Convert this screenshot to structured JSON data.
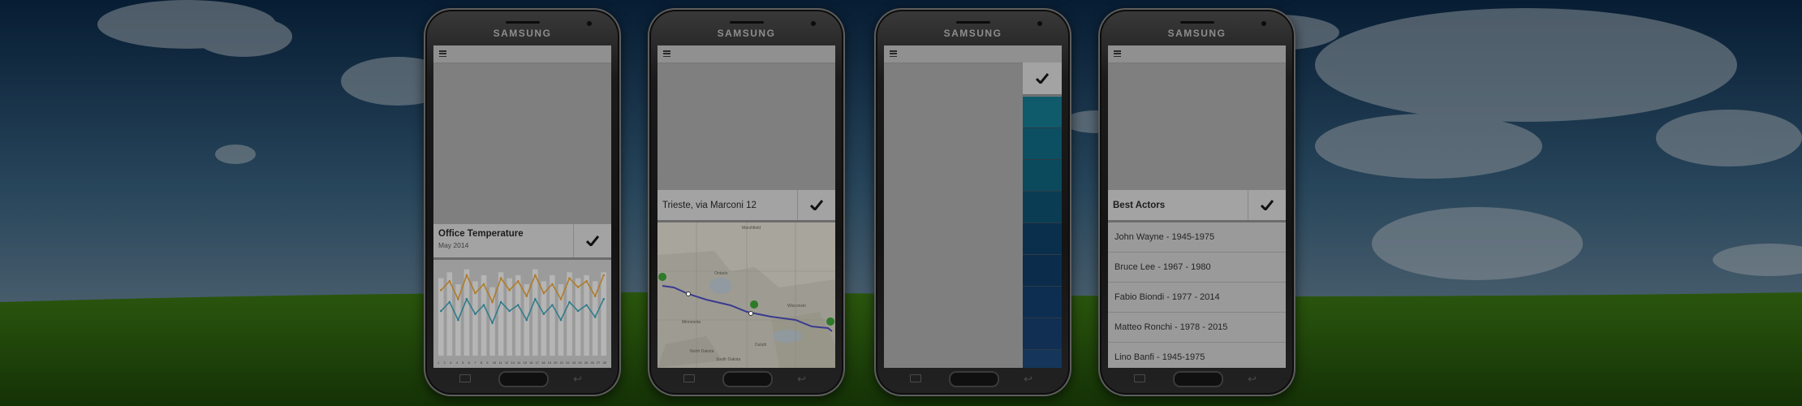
{
  "background": {
    "sky_top": "#0d2f52",
    "sky_bottom": "#5b7f99",
    "grass": "#2f6a12",
    "dim_overlay": "#000000"
  },
  "phones": [
    {
      "brand": "SAMSUNG",
      "menu_icon": "hamburger-menu-icon",
      "card": {
        "title": "Office Temperature",
        "subtitle": "May 2014",
        "confirm_icon": "checkmark-icon"
      },
      "chart": {
        "series": [
          {
            "values": [
              22,
              25,
              19,
              27,
              21,
              24,
              18,
              26,
              22,
              25,
              20,
              27,
              21,
              24,
              19,
              26,
              23,
              25,
              20,
              27
            ],
            "color": "#b07a24"
          },
          {
            "values": [
              15,
              18,
              12,
              19,
              14,
              17,
              11,
              18,
              15,
              17,
              12,
              19,
              14,
              17,
              12,
              18,
              15,
              17,
              13,
              19
            ],
            "color": "#2c7a8a"
          }
        ],
        "bars": [
          14,
          16,
          12,
          17,
          13,
          15,
          11,
          16,
          14,
          15,
          12,
          17,
          13,
          15,
          12,
          16,
          14,
          15,
          13,
          16
        ],
        "tick_labels": [
          "1",
          "2",
          "3",
          "4",
          "5",
          "6",
          "7",
          "8",
          "9",
          "10",
          "11",
          "12",
          "13",
          "14",
          "15",
          "16",
          "17",
          "18",
          "19",
          "20",
          "21",
          "22",
          "23",
          "24",
          "25",
          "26",
          "27",
          "28"
        ]
      }
    },
    {
      "brand": "SAMSUNG",
      "menu_icon": "hamburger-menu-icon",
      "card": {
        "title": "Trieste, via Marconi 12",
        "confirm_icon": "checkmark-icon"
      },
      "map": {
        "labels": [
          "Marshfield",
          "Ontario",
          "Duluth",
          "Minnesota",
          "North Dakota",
          "South Dakota",
          "Wisconsin"
        ],
        "route_color": "#3b3a8e",
        "marker_color": "#2e7a2a"
      }
    },
    {
      "brand": "SAMSUNG",
      "menu_icon": "hamburger-menu-icon",
      "confirm_icon": "checkmark-icon",
      "swatches": [
        "#0f5b6c",
        "#0c4e62",
        "#0a4a5c",
        "#0a3d53",
        "#0a2f4d",
        "#0c2c4b",
        "#0d2e50",
        "#102f52",
        "#15365a"
      ]
    },
    {
      "brand": "SAMSUNG",
      "menu_icon": "hamburger-menu-icon",
      "card": {
        "title": "Best Actors",
        "confirm_icon": "checkmark-icon"
      },
      "list": [
        "John Wayne - 1945-1975",
        "Bruce Lee - 1967 - 1980",
        "Fabio Biondi - 1977 - 2014",
        "Matteo Ronchi - 1978 - 2015",
        "Lino Banfi - 1945-1975"
      ]
    }
  ]
}
